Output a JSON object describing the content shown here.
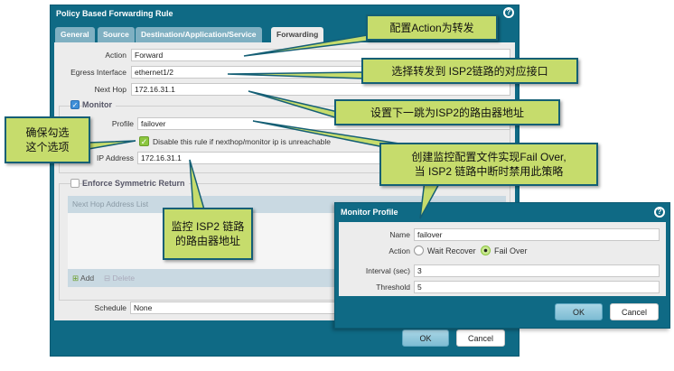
{
  "main_dialog": {
    "title": "Policy Based Forwarding Rule",
    "tabs": [
      {
        "label": "General"
      },
      {
        "label": "Source"
      },
      {
        "label": "Destination/Application/Service"
      },
      {
        "label": "Forwarding",
        "active": true
      }
    ],
    "action": {
      "label": "Action",
      "value": "Forward"
    },
    "egress": {
      "label": "Egress Interface",
      "value": "ethernet1/2"
    },
    "next_hop": {
      "label": "Next Hop",
      "value": "172.16.31.1"
    },
    "monitor": {
      "label": "Monitor",
      "checked": true,
      "profile": {
        "label": "Profile",
        "value": "failover"
      },
      "disable_rule": {
        "label": "Disable this rule if nexthop/monitor ip is unreachable",
        "checked": true
      },
      "ip_address": {
        "label": "IP Address",
        "value": "172.16.31.1"
      }
    },
    "symmetric": {
      "label": "Enforce Symmetric Return",
      "checked": false,
      "list_header": "Next Hop Address List",
      "add": "Add",
      "delete": "Delete"
    },
    "schedule": {
      "label": "Schedule",
      "value": "None"
    },
    "ok": "OK",
    "cancel": "Cancel"
  },
  "monitor_profile": {
    "title": "Monitor Profile",
    "name": {
      "label": "Name",
      "value": "failover"
    },
    "action": {
      "label": "Action",
      "options": [
        "Wait Recover",
        "Fail Over"
      ],
      "selected": "Fail Over"
    },
    "interval": {
      "label": "Interval (sec)",
      "value": "3"
    },
    "threshold": {
      "label": "Threshold",
      "value": "5"
    },
    "ok": "OK",
    "cancel": "Cancel"
  },
  "callouts": {
    "c1": "配置Action为转发",
    "c2": "选择转发到 ISP2链路的对应接口",
    "c3": "设置下一跳为ISP2的路由器地址",
    "c4a": "确保勾选",
    "c4b": "这个选项",
    "c5a": "创建监控配置文件实现Fail Over,",
    "c5b": "当 ISP2 链路中断时禁用此策略",
    "c6a": "监控 ISP2 链路",
    "c6b": "的路由器地址"
  },
  "colors": {
    "dialog": "#0f6a85",
    "callout": "#c6dc6c",
    "accent_radio": "#8cc63f"
  }
}
